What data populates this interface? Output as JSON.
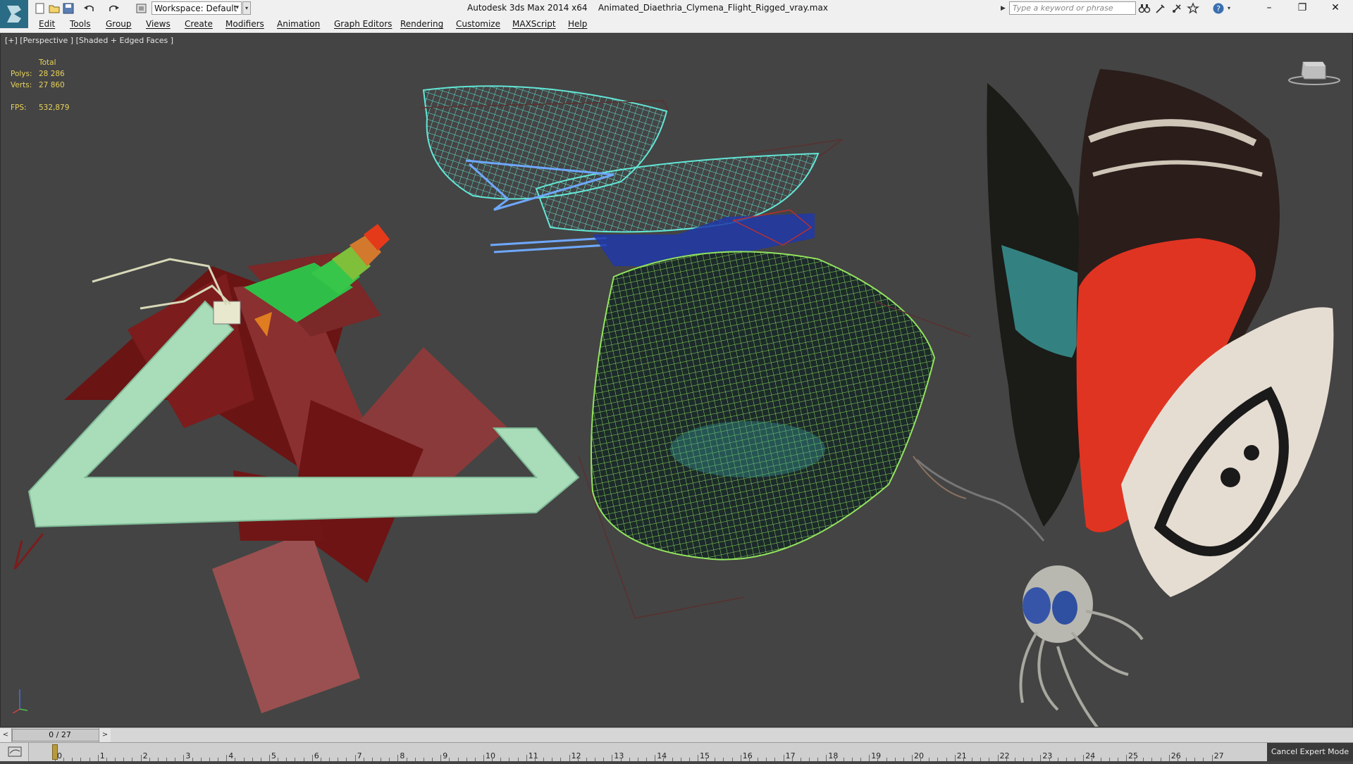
{
  "window": {
    "app_title": "Autodesk 3ds Max  2014 x64",
    "file_name": "Animated_Diaethria_Clymena_Flight_Rigged_vray.max",
    "workspace_label": "Workspace: Default",
    "search_placeholder": "Type a keyword or phrase"
  },
  "toolbar": {
    "icons": [
      "app-logo-icon",
      "new-file-icon",
      "open-file-icon",
      "save-file-icon",
      "undo-icon",
      "redo-icon",
      "project-folder-icon"
    ]
  },
  "info_icons": [
    "binoculars-icon",
    "communication-center-icon",
    "star-icon",
    "help-icon"
  ],
  "menu": [
    "Edit",
    "Tools",
    "Group",
    "Views",
    "Create",
    "Modifiers",
    "Animation",
    "Graph Editors",
    "Rendering",
    "Customize",
    "MAXScript",
    "Help"
  ],
  "viewport": {
    "label": "[+] [Perspective ] [Shaded + Edged Faces ]",
    "stats": {
      "header": "Total",
      "polys_label": "Polys:",
      "polys_value": "28 286",
      "verts_label": "Verts:",
      "verts_value": "27 860",
      "fps_label": "FPS:",
      "fps_value": "532,879"
    },
    "colors": {
      "background": "#444444",
      "stats_text": "#e8d25a",
      "wire_cyan": "#57e0d0",
      "wire_green": "#8fe05a",
      "rig_red": "#8a2222"
    }
  },
  "timeline": {
    "frame_display": "0 / 27",
    "current_frame": 0,
    "total_frames": 27,
    "ticks": [
      "0",
      "1",
      "2",
      "3",
      "4",
      "5",
      "6",
      "7",
      "8",
      "9",
      "10",
      "11",
      "12",
      "13",
      "14",
      "15",
      "16",
      "17",
      "18",
      "19",
      "20",
      "21",
      "22",
      "23",
      "24",
      "25",
      "26",
      "27"
    ]
  },
  "status": {
    "cancel_expert_label": "Cancel Expert Mode"
  }
}
